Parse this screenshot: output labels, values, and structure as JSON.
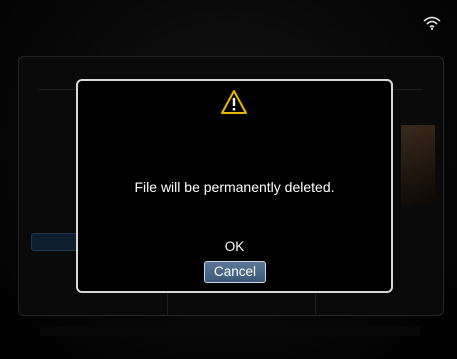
{
  "status_bar": {
    "wifi_icon": "wifi-icon"
  },
  "dialog": {
    "icon": "warning-icon",
    "message": "File will be permanently deleted.",
    "options": [
      {
        "label": "OK",
        "selected": false
      },
      {
        "label": "Cancel",
        "selected": true
      }
    ],
    "colors": {
      "border": "#d8d8d8",
      "selected_bg": "#4a6886",
      "icon": "#e6b800"
    }
  }
}
